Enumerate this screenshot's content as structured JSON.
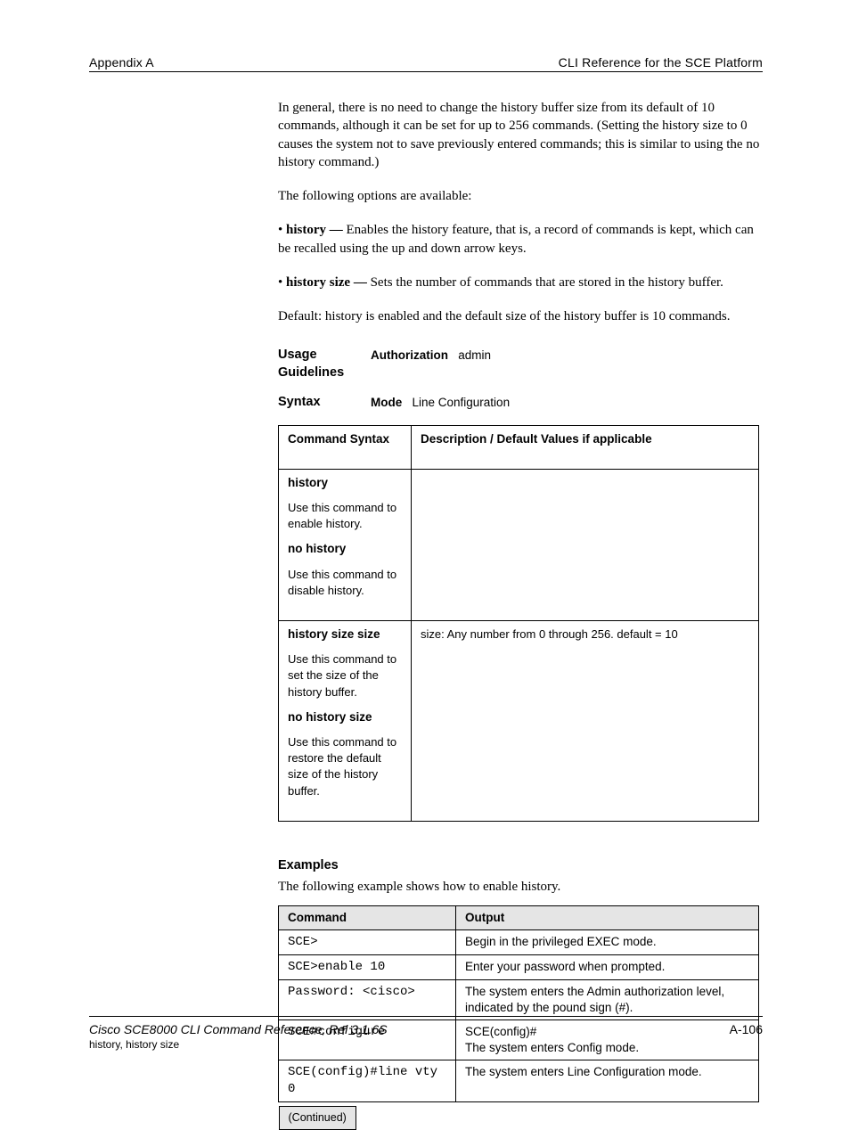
{
  "header": {
    "left": "Appendix A",
    "right": "CLI Reference for the SCE Platform"
  },
  "intro": {
    "p1": "In general, there is no need to change the history buffer size from its default of 10 commands, although it can be set for up to 256 commands. (Setting the history size to 0 causes the system not to save previously entered commands; this is similar to using the no history command.)",
    "p2": "The following options are available:",
    "b1_label": "history —",
    "b1_text": "Enables the history feature, that is, a record of commands is kept, which can be recalled using the up and down arrow keys.",
    "b2_label": "history size —",
    "b2_text": "Sets the number of commands that are stored in the history buffer.",
    "def_form": "Default: history is enabled and the default size of the history buffer is 10 commands."
  },
  "syntax": {
    "usage": "Usage Guidelines",
    "syntax_label": "Syntax",
    "authorization": "Authorization",
    "admin": "admin",
    "mode": "Mode",
    "line_conf": "Line Configuration"
  },
  "table1": {
    "row1": {
      "label": "Command Syntax",
      "desc": "Description / Default Values if applicable"
    },
    "row2": {
      "label1": "history",
      "note1": "Use this command to enable history.",
      "label2": "no history",
      "note2": "Use this command to disable history."
    },
    "row3": {
      "label1": "history size size",
      "note1": "Use this command to set the size of the history buffer.",
      "label2": "no history size",
      "note2": "Use this command to restore the default size of the history buffer.",
      "size_def": "size: Any number from 0 through 256. default = 10"
    }
  },
  "examples_heading": "Examples",
  "examples_intro": "The following example shows how to enable history.",
  "table2": {
    "head1": "Command",
    "head2": "Output",
    "rows": [
      {
        "c": "SCE>",
        "o": "Begin in the privileged EXEC mode."
      },
      {
        "c": "SCE>enable 10",
        "o": "Enter your password when prompted."
      },
      {
        "c": "Password: <cisco>",
        "o": "The system enters the Admin authorization level, indicated by the pound sign (#)."
      },
      {
        "c": "SCE#configure",
        "o": "SCE(config)#\nThe system enters Config mode."
      },
      {
        "c": "SCE(config)#line vty 0",
        "o": "The system enters Line Configuration mode."
      }
    ],
    "continued": "(Continued)"
  },
  "footer": {
    "left": "Cisco SCE8000 CLI Command Reference, Rel 3.1.6S",
    "right": "A-106",
    "sub": "history, history size"
  }
}
